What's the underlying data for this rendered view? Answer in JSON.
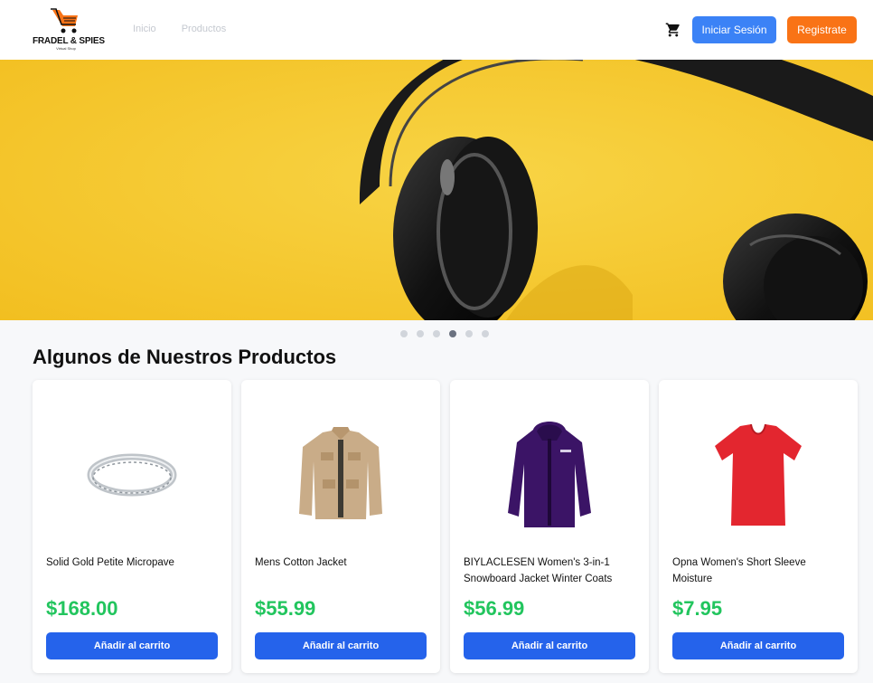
{
  "header": {
    "logo_brand": "FRADEL & SPIES",
    "logo_tagline": "Virtual Shop",
    "nav": [
      {
        "label": "Inicio"
      },
      {
        "label": "Productos"
      }
    ],
    "login_label": "Iniciar Sesión",
    "register_label": "Registrate",
    "cart_icon": "shopping-cart-icon"
  },
  "carousel": {
    "slide_count": 6,
    "active_index": 3
  },
  "section": {
    "title": "Algunos de Nuestros Productos"
  },
  "products": [
    {
      "name": "Solid Gold Petite Micropave",
      "price": "$168.00",
      "button": "Añadir al carrito"
    },
    {
      "name": "Mens Cotton Jacket",
      "price": "$55.99",
      "button": "Añadir al carrito"
    },
    {
      "name": "BIYLACLESEN Women's 3-in-1 Snowboard Jacket Winter Coats",
      "price": "$56.99",
      "button": "Añadir al carrito"
    },
    {
      "name": "Opna Women's Short Sleeve Moisture",
      "price": "$7.95",
      "button": "Añadir al carrito"
    }
  ],
  "colors": {
    "primary": "#3b82f6",
    "button_blue": "#2563eb",
    "accent_orange": "#f97316",
    "price_green": "#22c55e",
    "hero_yellow": "#f5c62d"
  }
}
